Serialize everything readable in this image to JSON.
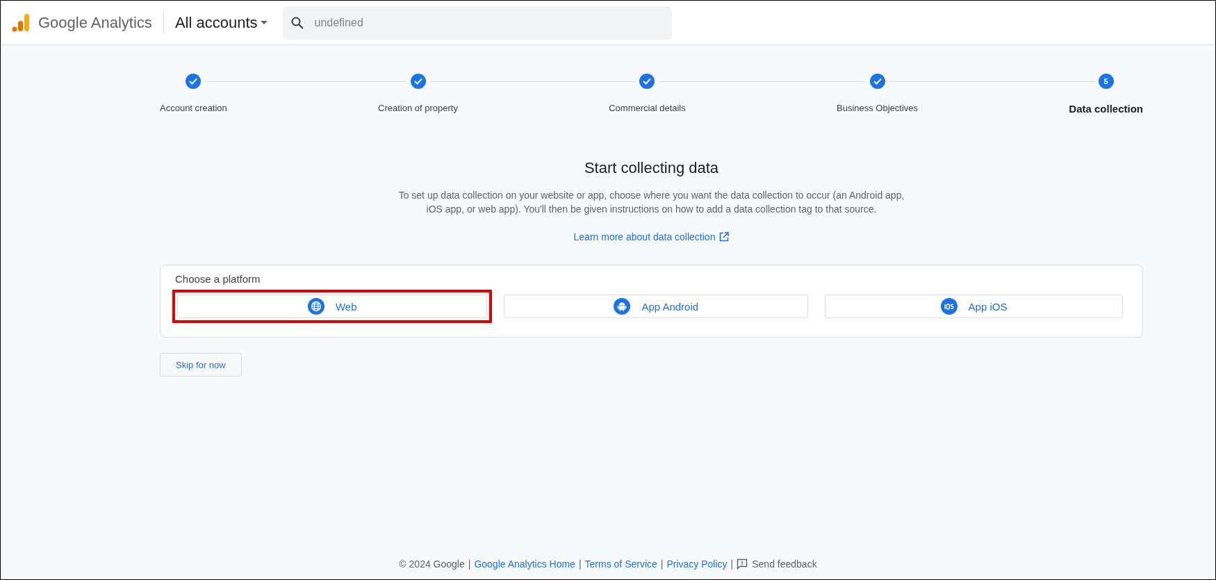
{
  "header": {
    "product": "Google Analytics",
    "account_picker": "All accounts",
    "search": {
      "placeholder": "undefined"
    }
  },
  "steps": [
    {
      "label": "Account creation",
      "kind": "done",
      "selected": false
    },
    {
      "label": "Creation of property",
      "kind": "done",
      "selected": false
    },
    {
      "label": "Commercial details",
      "kind": "done",
      "selected": false
    },
    {
      "label": "Business Objectives",
      "kind": "done",
      "selected": false
    },
    {
      "label": "Data collection",
      "kind": "current",
      "number": "5",
      "selected": true
    }
  ],
  "intro": {
    "title": "Start collecting data",
    "text": "To set up data collection on your website or app, choose where you want the data collection to occur (an Android app, iOS app, or web app). You'll then be given instructions on how to add a data collection tag to that source.",
    "link": "Learn more about data collection"
  },
  "platform_card": {
    "title": "Choose a platform",
    "platforms": [
      {
        "label": "Web",
        "kind": "web",
        "highlighted": true
      },
      {
        "label": "App Android",
        "kind": "android",
        "highlighted": false
      },
      {
        "label": "App iOS",
        "kind": "ios",
        "highlighted": false
      }
    ]
  },
  "skip_button": "Skip for now",
  "footer": [
    {
      "kind": "text",
      "text": "© 2024 Google"
    },
    {
      "kind": "separator",
      "text": "|"
    },
    {
      "kind": "link",
      "text": "Google Analytics Home"
    },
    {
      "kind": "separator",
      "text": "|"
    },
    {
      "kind": "link",
      "text": "Terms of Service"
    },
    {
      "kind": "separator",
      "text": "|"
    },
    {
      "kind": "link",
      "text": "Privacy Policy"
    },
    {
      "kind": "separator",
      "text": "|"
    },
    {
      "kind": "feedback",
      "text": "Send feedback"
    }
  ]
}
